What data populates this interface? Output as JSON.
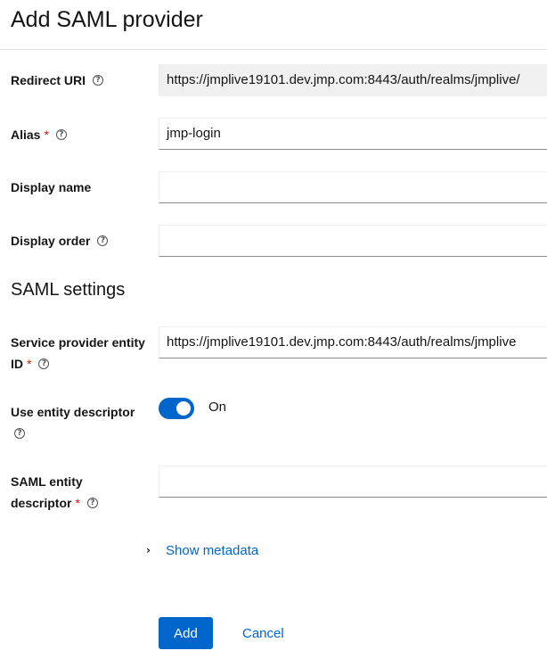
{
  "page": {
    "title": "Add SAML provider"
  },
  "fields": {
    "redirect_uri": {
      "label": "Redirect URI",
      "value": "https://jmplive19101.dev.jmp.com:8443/auth/realms/jmplive/"
    },
    "alias": {
      "label": "Alias",
      "value": "jmp-login"
    },
    "display_name": {
      "label": "Display name",
      "value": ""
    },
    "display_order": {
      "label": "Display order",
      "value": ""
    }
  },
  "saml": {
    "section_title": "SAML settings",
    "sp_entity_id": {
      "label_line1": "Service provider entity",
      "label_line2": "ID",
      "value": "https://jmplive19101.dev.jmp.com:8443/auth/realms/jmplive"
    },
    "use_entity_descriptor": {
      "label": "Use entity descriptor",
      "state": "On"
    },
    "entity_descriptor": {
      "label_line1": "SAML entity",
      "label_line2": "descriptor",
      "value": ""
    },
    "show_metadata": "Show metadata"
  },
  "required_mark": "*",
  "help_glyph": "?",
  "chevron_glyph": "›",
  "actions": {
    "add": "Add",
    "cancel": "Cancel"
  },
  "colors": {
    "primary": "#0066cc",
    "required": "#c9190b",
    "readonly_bg": "#f0f0f0"
  }
}
